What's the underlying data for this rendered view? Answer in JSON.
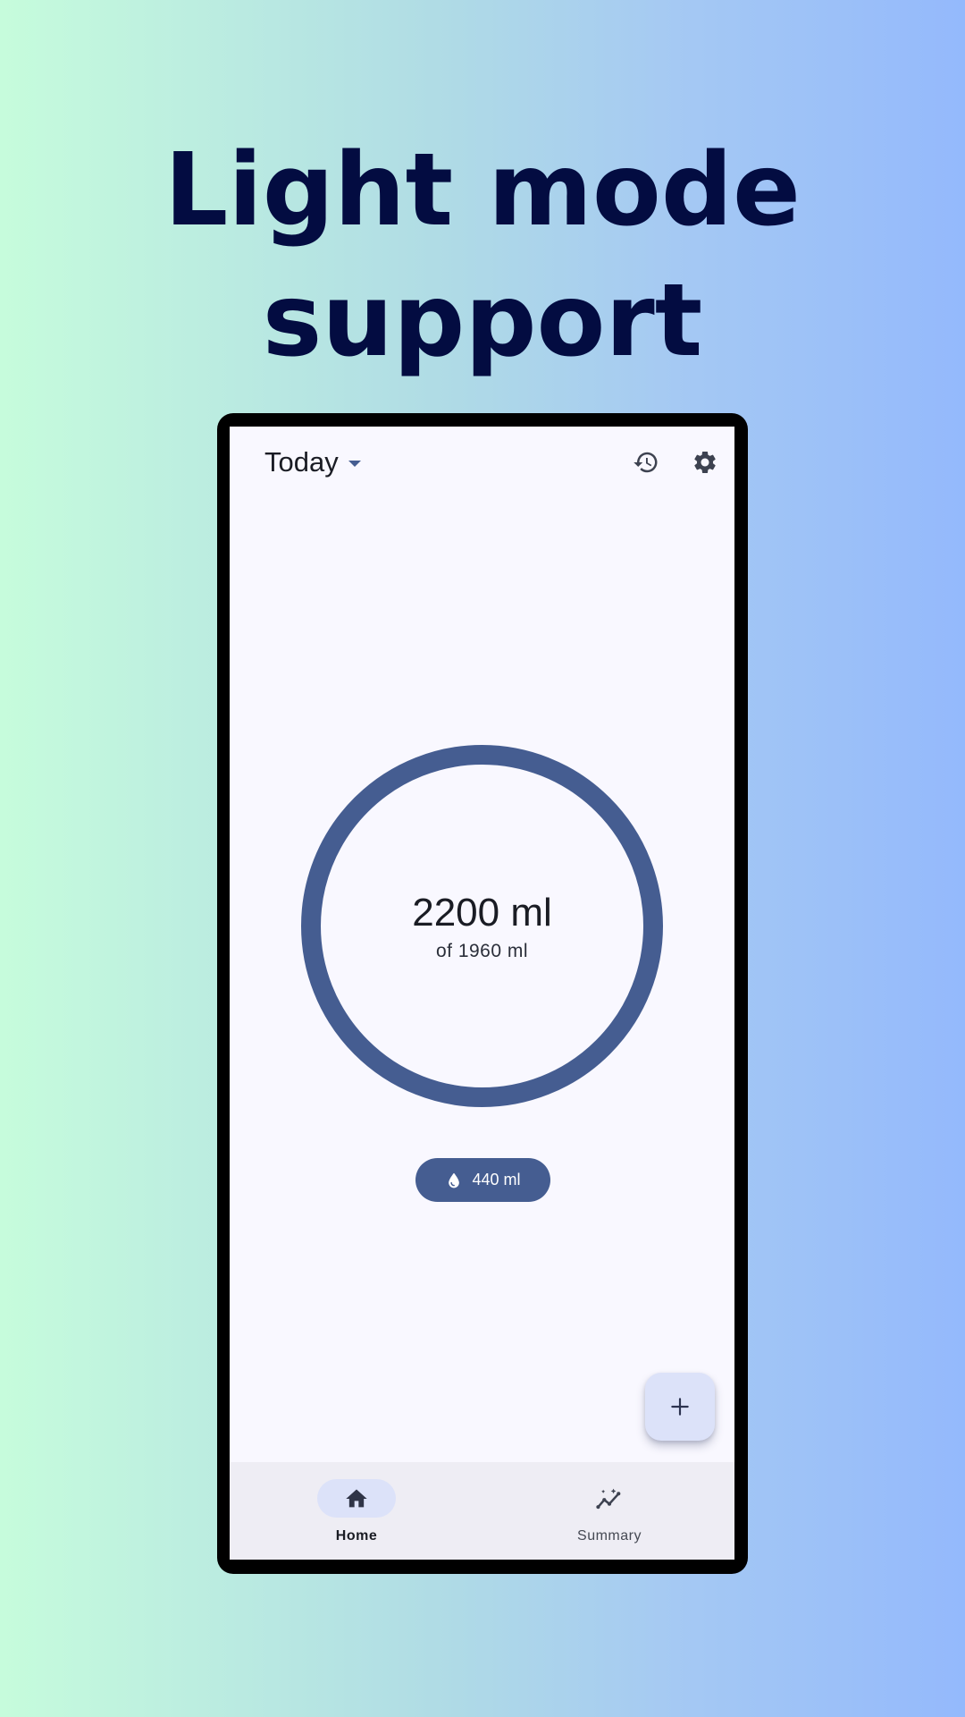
{
  "headline": {
    "line1": "Light mode",
    "line2": "support"
  },
  "app": {
    "topbar": {
      "title": "Today",
      "history_icon": "history-icon",
      "settings_icon": "gear-icon"
    },
    "progress": {
      "current": "2200 ml",
      "goal": "of 1960 ml",
      "fraction": 1.0,
      "ring_color": "#455d91"
    },
    "chip": {
      "icon": "water-drop-icon",
      "label": "440 ml"
    },
    "fab": {
      "icon": "plus-icon"
    },
    "bottom_nav": {
      "items": [
        {
          "label": "Home",
          "icon": "home-icon",
          "selected": true
        },
        {
          "label": "Summary",
          "icon": "insights-icon",
          "selected": false
        }
      ]
    }
  },
  "colors": {
    "headline": "#030c41",
    "accent": "#455d91",
    "surface": "#f9f8ff",
    "nav_background": "#eeedf4",
    "selected_pill": "#dce2f9"
  }
}
